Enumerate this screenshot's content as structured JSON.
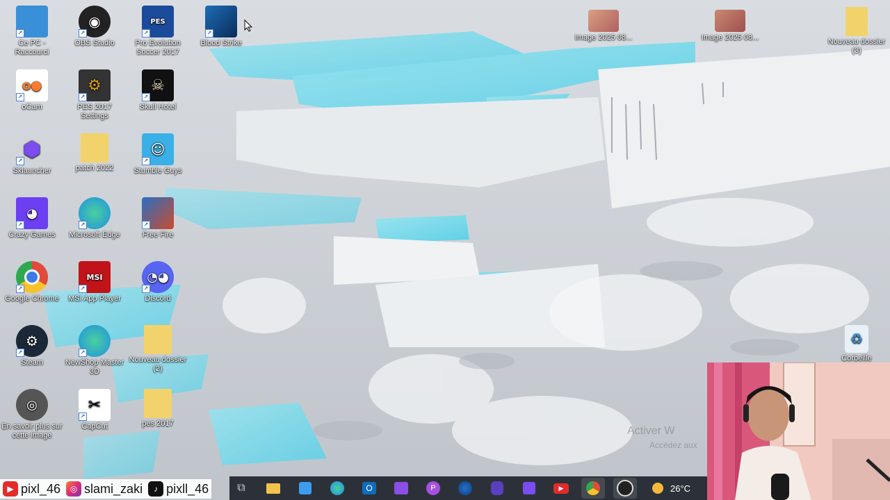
{
  "desktop_icons": [
    {
      "label": "Ce PC -\nRaccourci",
      "icon": "computer-icon",
      "color": "#3a8fd9"
    },
    {
      "label": "OBS Studio",
      "icon": "obs-icon",
      "color": "#222"
    },
    {
      "label": "Pro Evolution\nSoccer 2017",
      "icon": "pes-icon",
      "color": "#1b4a9a"
    },
    {
      "label": "Blood Strike",
      "icon": "blood-strike-icon",
      "color": "#1e6db7"
    },
    {
      "label": "oCam",
      "icon": "ocam-icon",
      "color": "#ff7a2a"
    },
    {
      "label": "PES 2017 Settings",
      "icon": "pes-settings-icon",
      "color": "#333"
    },
    {
      "label": "Skull Hotel",
      "icon": "skull-icon",
      "color": "#111"
    },
    {
      "label": "Sklauncher",
      "icon": "sklauncher-icon",
      "color": "#6b42d4"
    },
    {
      "label": "patch 2022",
      "icon": "folder-icon",
      "color": "#f2d36b"
    },
    {
      "label": "Stumble Guys",
      "icon": "stumble-icon",
      "color": "#3ab0e6"
    },
    {
      "label": "Crazy Games",
      "icon": "crazygames-icon",
      "color": "#6d3ff2"
    },
    {
      "label": "Microsoft Edge",
      "icon": "edge-icon",
      "color": "#1f8fe0"
    },
    {
      "label": "Free Fire",
      "icon": "freefire-icon",
      "color": "#c94b2e"
    },
    {
      "label": "Google Chrome",
      "icon": "chrome-icon",
      "color": "#e04b3a"
    },
    {
      "label": "MSI App Player",
      "icon": "msi-icon",
      "color": "#c0141a"
    },
    {
      "label": "Discord",
      "icon": "discord-icon",
      "color": "#5865f2"
    },
    {
      "label": "Steam",
      "icon": "steam-icon",
      "color": "#1b2838"
    },
    {
      "label": "NewShop Master\n3D",
      "icon": "edge-icon",
      "color": "#1f8fe0"
    },
    {
      "label": "Nouveau dossier\n(2)",
      "icon": "folder-icon",
      "color": "#f2d36b"
    },
    {
      "label": "En savoir plus sur\ncette image",
      "icon": "camera-icon",
      "color": "#555"
    },
    {
      "label": "CapCut",
      "icon": "capcut-icon",
      "color": "#fff"
    },
    {
      "label": "pes 2017",
      "icon": "folder-icon",
      "color": "#f2d36b"
    },
    {
      "label": "Image 2025 08...",
      "icon": "image-icon",
      "color": "#b06060"
    },
    {
      "label": "Image 2025 08...",
      "icon": "image-icon",
      "color": "#a05050"
    },
    {
      "label": "Nouveau dossier\n(3)",
      "icon": "folder-icon",
      "color": "#f2d36b"
    },
    {
      "label": "Corbeille",
      "icon": "recycle-bin-icon",
      "color": "#e8f0f8"
    }
  ],
  "social": [
    {
      "platform": "youtube",
      "handle": "pixl_46"
    },
    {
      "platform": "instagram",
      "handle": "slami_zaki"
    },
    {
      "platform": "tiktok",
      "handle": "pixll_46"
    }
  ],
  "taskbar": {
    "apps": [
      "task-view-icon",
      "file-explorer-icon",
      "store-icon",
      "edge-icon",
      "outlook-icon",
      "clipchamp-icon",
      "picsart-icon",
      "edge-dev-icon",
      "bot-icon",
      "twitch-icon",
      "youtube-icon",
      "chrome-icon",
      "obs-icon"
    ],
    "weather": "26°C"
  },
  "watermark": {
    "line1": "Activer W",
    "line2": "Accédez aux"
  }
}
